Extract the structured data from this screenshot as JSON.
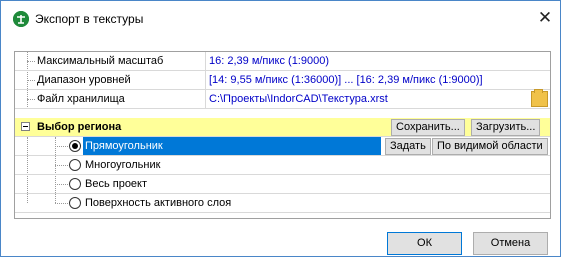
{
  "window": {
    "title": "Экспорт в текстуры",
    "close_symbol": "✕",
    "icon": "app-logo-icon"
  },
  "properties": [
    {
      "name": "Максимальный масштаб",
      "value": "16: 2,39 м/пикс (1:9000)"
    },
    {
      "name": "Диапазон уровней",
      "value": "[14: 9,55 м/пикс (1:36000)] ... [16: 2,39 м/пикс (1:9000)]"
    },
    {
      "name": "Файл хранилища",
      "value": "C:\\Проекты\\IndorCAD\\Текстура.xrst"
    }
  ],
  "region": {
    "title": "Выбор региона",
    "save_label": "Сохранить...",
    "load_label": "Загрузить...",
    "options": [
      {
        "label": "Прямоугольник",
        "selected": true
      },
      {
        "label": "Многоугольник",
        "selected": false
      },
      {
        "label": "Весь проект",
        "selected": false
      },
      {
        "label": "Поверхность активного слоя",
        "selected": false
      }
    ],
    "set_label": "Задать",
    "visible_area_label": "По видимой области"
  },
  "footer": {
    "ok_label": "ОК",
    "cancel_label": "Отмена"
  },
  "colors": {
    "value_text": "#0000c8",
    "section_bg": "#ffff99",
    "selection": "#0078d7"
  }
}
